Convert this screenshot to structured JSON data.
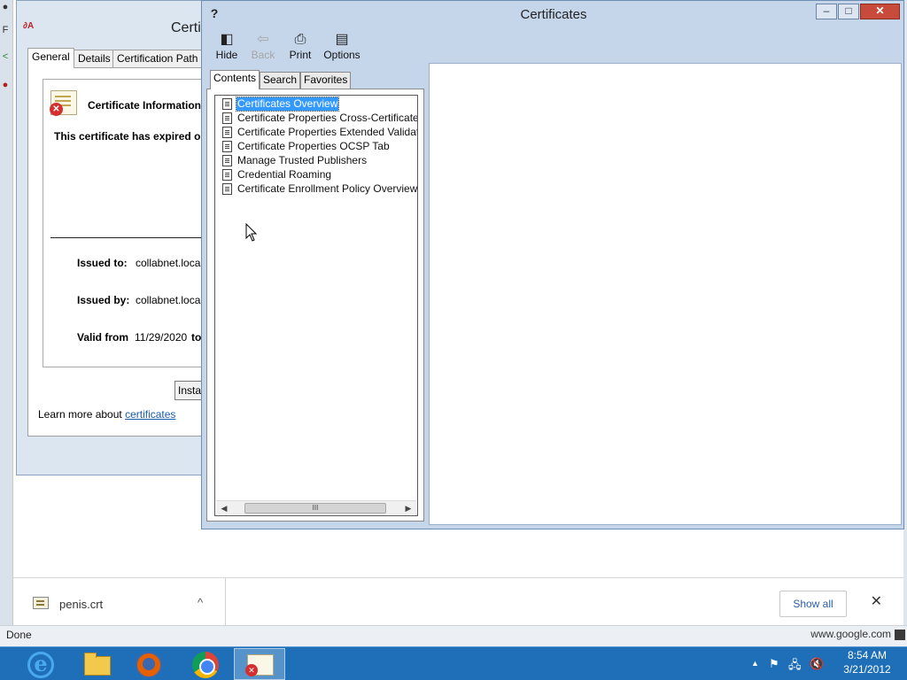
{
  "browser": {
    "status_text": "Done",
    "status_url": "www.google.com",
    "download": {
      "filename": "penis.crt",
      "chevron": "^",
      "show_all": "Show all",
      "close": "✕"
    }
  },
  "cert_dialog": {
    "title": "Certifi",
    "title_icon_text": "∂A",
    "tabs": [
      "General",
      "Details",
      "Certification Path"
    ],
    "info_title": "Certificate Information",
    "expired_text": "This certificate has expired or",
    "issued_to_label": "Issued to:",
    "issued_to_value": "collabnet.local",
    "issued_by_label": "Issued by:",
    "issued_by_value": "collabnet.local",
    "valid_from_label": "Valid from",
    "valid_from_value": "11/29/2020",
    "valid_to_label": "to",
    "install_button": "Instal",
    "learn_more_prefix": "Learn more about",
    "learn_more_link": "certificates"
  },
  "help_window": {
    "title": "Certificates",
    "controls": {
      "minimize": "–",
      "maximize": "□",
      "close": "✕"
    },
    "toolbar": [
      {
        "label": "Hide",
        "icon": "hide-icon",
        "glyph": "◧",
        "enabled": true
      },
      {
        "label": "Back",
        "icon": "back-arrow-icon",
        "glyph": "⇦",
        "enabled": false
      },
      {
        "label": "Print",
        "icon": "printer-icon",
        "glyph": "⎙",
        "enabled": true
      },
      {
        "label": "Options",
        "icon": "options-icon",
        "glyph": "▤",
        "enabled": true
      }
    ],
    "nav_tabs": [
      "Contents",
      "Search",
      "Favorites"
    ],
    "active_nav_tab": "Contents",
    "contents": [
      "Certificates Overview",
      "Certificate Properties Cross-Certificate Tab",
      "Certificate Properties Extended Validation Tab",
      "Certificate Properties OCSP Tab",
      "Manage Trusted Publishers",
      "Credential Roaming",
      "Certificate Enrollment Policy Overview"
    ],
    "selected_index": 0,
    "scroll": {
      "left": "◀",
      "right": "▶",
      "thumb": "III"
    }
  },
  "taskbar": {
    "apps": [
      {
        "name": "internet-explorer",
        "glyph": "e"
      },
      {
        "name": "file-explorer",
        "glyph": ""
      },
      {
        "name": "firefox",
        "glyph": ""
      },
      {
        "name": "chrome",
        "glyph": ""
      },
      {
        "name": "certificate-viewer",
        "glyph": ""
      }
    ],
    "active_app": "certificate-viewer",
    "tray": {
      "time": "8:54 AM",
      "date": "3/21/2012",
      "glyphs": [
        "▲",
        "⚑",
        "🖧",
        "🔇"
      ]
    }
  },
  "colors": {
    "taskbar": "#1e6fb8",
    "selection": "#3399ff",
    "close_button": "#c84a3a",
    "link": "#1a5aaa"
  }
}
